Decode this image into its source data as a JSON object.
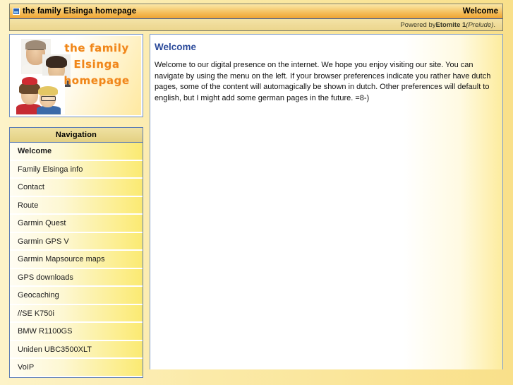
{
  "header": {
    "icon": "site-page-icon",
    "title": "the family Elsinga homepage",
    "page_label": "Welcome"
  },
  "powered": {
    "prefix": "Powered by ",
    "product": "Etomite 1",
    "release": " (Prelude)",
    "suffix": "."
  },
  "logo": {
    "line1": "the family",
    "line2": "Elsinga",
    "line3": "homepage",
    "accent_color": "#f0861a"
  },
  "navigation": {
    "title": "Navigation",
    "items": [
      {
        "label": "Welcome",
        "active": true
      },
      {
        "label": "Family Elsinga info",
        "active": false
      },
      {
        "label": "Contact",
        "active": false
      },
      {
        "label": "Route",
        "active": false
      },
      {
        "label": "Garmin Quest",
        "active": false
      },
      {
        "label": "Garmin GPS V",
        "active": false
      },
      {
        "label": "Garmin Mapsource maps",
        "active": false
      },
      {
        "label": "GPS downloads",
        "active": false
      },
      {
        "label": "Geocaching",
        "active": false
      },
      {
        "label": "//SE K750i",
        "active": false
      },
      {
        "label": "BMW R1100GS",
        "active": false
      },
      {
        "label": "Uniden UBC3500XLT",
        "active": false
      },
      {
        "label": "VoIP",
        "active": false
      }
    ]
  },
  "content": {
    "title": "Welcome",
    "body": "Welcome to our digital presence on the internet. We hope you enjoy visiting our site. You can navigate by using the menu on the left. If your browser preferences indicate you rather have dutch pages, some of the content will automagically be shown in dutch. Other preferences will default to english, but I might add some german pages in the future. =8-)"
  },
  "colors": {
    "header_orange": "#f0ab3e",
    "title_blue": "#2c4b9b",
    "page_yellow": "#f9e08a",
    "border_blue": "#5b7cb4"
  }
}
